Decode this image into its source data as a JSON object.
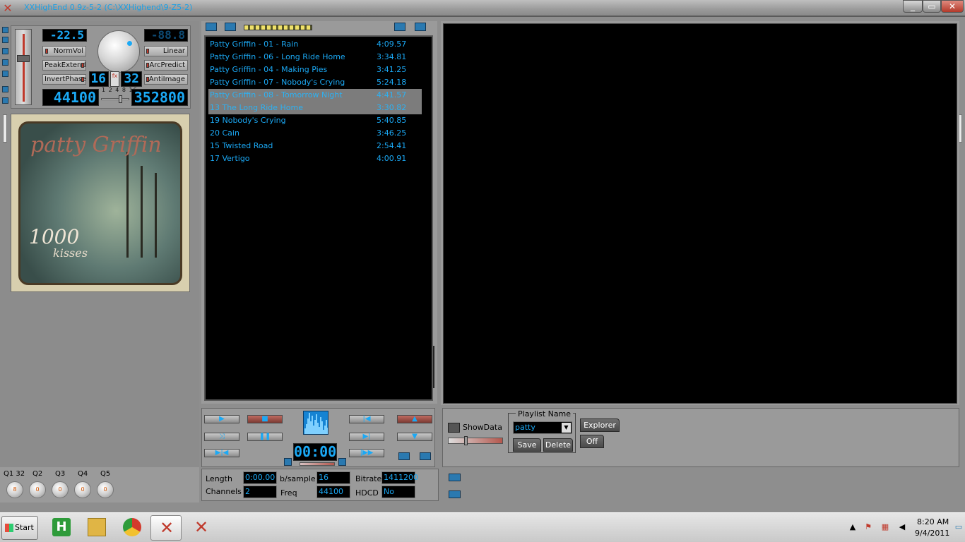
{
  "window": {
    "title": "XXHighEnd 0.9z-5-2 (C:\\XXHighend\\9-Z5-2)",
    "controls": [
      "_",
      "▭",
      "✕"
    ]
  },
  "controls": {
    "volume_db": "-22.5",
    "right_db": "-88.8",
    "options_left": [
      "NormVol",
      "PeakExtend",
      "InvertPhase"
    ],
    "options_right": [
      "Linear",
      "ArcPredict",
      "AntiImage"
    ],
    "bits_in": "16",
    "fx_label": "fx",
    "bits_out": "32",
    "rate_in": "44100",
    "rate_out": "352800",
    "ticks": "1 2 4 8 16"
  },
  "album_art": {
    "artist": "patty Griffin",
    "album": "1000",
    "album_sub": "kisses"
  },
  "playlist": {
    "tracks": [
      {
        "name": "Patty Griffin - 01 - Rain",
        "time": "4:09.57",
        "selected": false
      },
      {
        "name": "Patty Griffin - 06 - Long Ride Home",
        "time": "3:34.81",
        "selected": false
      },
      {
        "name": "Patty Griffin - 04 - Making Pies",
        "time": "3:41.25",
        "selected": false
      },
      {
        "name": "Patty Griffin - 07 - Nobody's Crying",
        "time": "5:24.18",
        "selected": false
      },
      {
        "name": "Patty Griffin - 08 - Tomorrow Night",
        "time": "4:41.57",
        "selected": true
      },
      {
        "name": "13 The Long Ride Home",
        "time": "3:30.82",
        "selected": true
      },
      {
        "name": "19 Nobody's Crying",
        "time": "5:40.85",
        "selected": false
      },
      {
        "name": "20 Cain",
        "time": "3:46.25",
        "selected": false
      },
      {
        "name": "15 Twisted Road",
        "time": "2:54.41",
        "selected": false
      },
      {
        "name": "17 Vertigo",
        "time": "4:00.91",
        "selected": false
      }
    ]
  },
  "transport": {
    "time": "00:00",
    "buttons": {
      "play": "▶",
      "stop": "■",
      "pause": "❚❚",
      "prev": "|◀",
      "next": "▶|",
      "up": "▲",
      "down": "▼",
      "shuffle": "⤨",
      "repeat": "▶|◀",
      "skip": "|▶▶"
    }
  },
  "bottom_right": {
    "showdata_label": "ShowData",
    "playlist_name_legend": "Playlist Name",
    "playlist_name_value": "patty",
    "dropdown_arrow": "▼",
    "save_label": "Save",
    "delete_label": "Delete",
    "explorer_label": "Explorer",
    "off_label": "Off"
  },
  "eq": {
    "labels": [
      "Q1 32",
      "Q2",
      "Q3",
      "Q4",
      "Q5"
    ],
    "knob_values": [
      "8",
      "0",
      "0",
      "0",
      "0"
    ]
  },
  "info": {
    "length_label": "Length",
    "length_value": "0:00.00",
    "channels_label": "Channels",
    "channels_value": "2",
    "bsample_label": "b/sample",
    "bsample_value": "16",
    "freq_label": "Freq",
    "freq_value": "44100",
    "bitrate_label": "Bitrate",
    "bitrate_value": "1411200",
    "hdcd_label": "HDCD",
    "hdcd_value": "No"
  },
  "taskbar": {
    "start_label": "Start",
    "apps": [
      {
        "name": "H",
        "color": "#2e9b3a"
      },
      {
        "name": "folder",
        "color": "#e0b545"
      },
      {
        "name": "chrome",
        "color": "#d33a2c"
      },
      {
        "name": "xxhighend",
        "color": "#c0392b"
      },
      {
        "name": "xxhighend2",
        "color": "#c0392b"
      }
    ],
    "clock_time": "8:20 AM",
    "clock_date": "9/4/2011"
  },
  "colors": {
    "accent_blue": "#1ba9f5",
    "led_red": "#c0392b",
    "panel_grey": "#9a9a9a"
  }
}
